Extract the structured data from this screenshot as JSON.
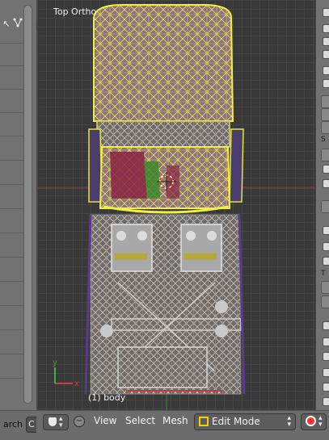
{
  "viewport": {
    "view_name": "Top Ortho",
    "object_info": "(1) body",
    "accent_wire_selected": "#e7e43a",
    "accent_wire_unselected": "#8c8c8c"
  },
  "left_panel": {
    "add_button": "+",
    "icon_names": [
      "split-arrow-icon",
      "node-tree-icon"
    ]
  },
  "header": {
    "search_fragment": "arch",
    "left_box_fragment": "C",
    "menu": [
      "View",
      "Select",
      "Mesh"
    ],
    "mode_selector": "Edit Mode",
    "editor_type_icon": "3d-view-icon",
    "shading_icon": "shading-sphere-icon"
  },
  "right_panel": {
    "labels": [
      "S",
      "T"
    ]
  }
}
